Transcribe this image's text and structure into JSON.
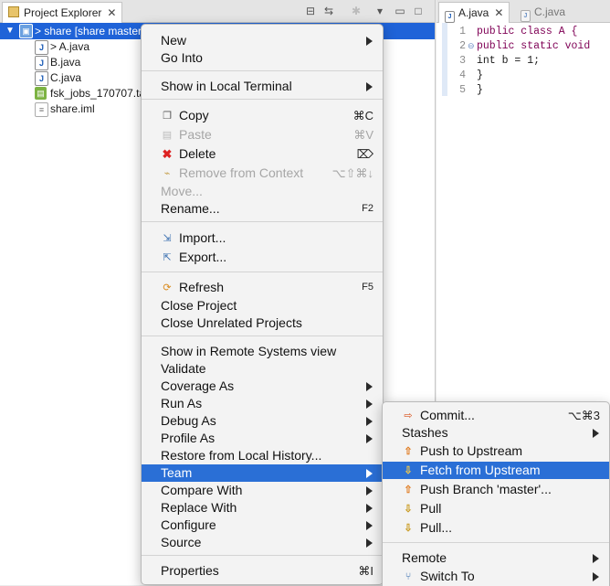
{
  "explorer": {
    "tab_label": "Project Explorer",
    "tree": [
      {
        "label": "> share [share master",
        "kind": "project",
        "selected": true
      },
      {
        "label": "> A.java",
        "kind": "java"
      },
      {
        "label": "B.java",
        "kind": "java"
      },
      {
        "label": "C.java",
        "kind": "java"
      },
      {
        "label": "fsk_jobs_170707.ta",
        "kind": "archive"
      },
      {
        "label": "share.iml",
        "kind": "iml"
      }
    ]
  },
  "editor": {
    "tabs": [
      {
        "label": "A.java",
        "active": true
      },
      {
        "label": "C.java",
        "active": false
      }
    ],
    "lines": [
      {
        "num": "1",
        "text": "public class A {"
      },
      {
        "num": "2",
        "text": "    public static void"
      },
      {
        "num": "3",
        "text": "        int b = 1;"
      },
      {
        "num": "4",
        "text": "    }"
      },
      {
        "num": "5",
        "text": "}"
      }
    ]
  },
  "context_menu": {
    "new": "New",
    "go_into": "Go Into",
    "show_local_terminal": "Show in Local Terminal",
    "copy": "Copy",
    "copy_sc": "⌘C",
    "paste": "Paste",
    "paste_sc": "⌘V",
    "delete": "Delete",
    "delete_sc": "⌦",
    "remove_context": "Remove from Context",
    "remove_context_sc": "⌥⇧⌘↓",
    "move": "Move...",
    "rename": "Rename...",
    "rename_sc": "F2",
    "import": "Import...",
    "export": "Export...",
    "refresh": "Refresh",
    "refresh_sc": "F5",
    "close_project": "Close Project",
    "close_unrelated": "Close Unrelated Projects",
    "show_remote": "Show in Remote Systems view",
    "validate": "Validate",
    "coverage_as": "Coverage As",
    "run_as": "Run As",
    "debug_as": "Debug As",
    "profile_as": "Profile As",
    "restore_history": "Restore from Local History...",
    "team": "Team",
    "compare_with": "Compare With",
    "replace_with": "Replace With",
    "configure": "Configure",
    "source": "Source",
    "properties": "Properties",
    "properties_sc": "⌘I"
  },
  "team_menu": {
    "commit": "Commit...",
    "commit_sc": "⌥⌘3",
    "stashes": "Stashes",
    "push_upstream": "Push to Upstream",
    "fetch_upstream": "Fetch from Upstream",
    "push_branch": "Push Branch 'master'...",
    "pull": "Pull",
    "pull_dots": "Pull...",
    "remote": "Remote",
    "switch_to": "Switch To"
  }
}
